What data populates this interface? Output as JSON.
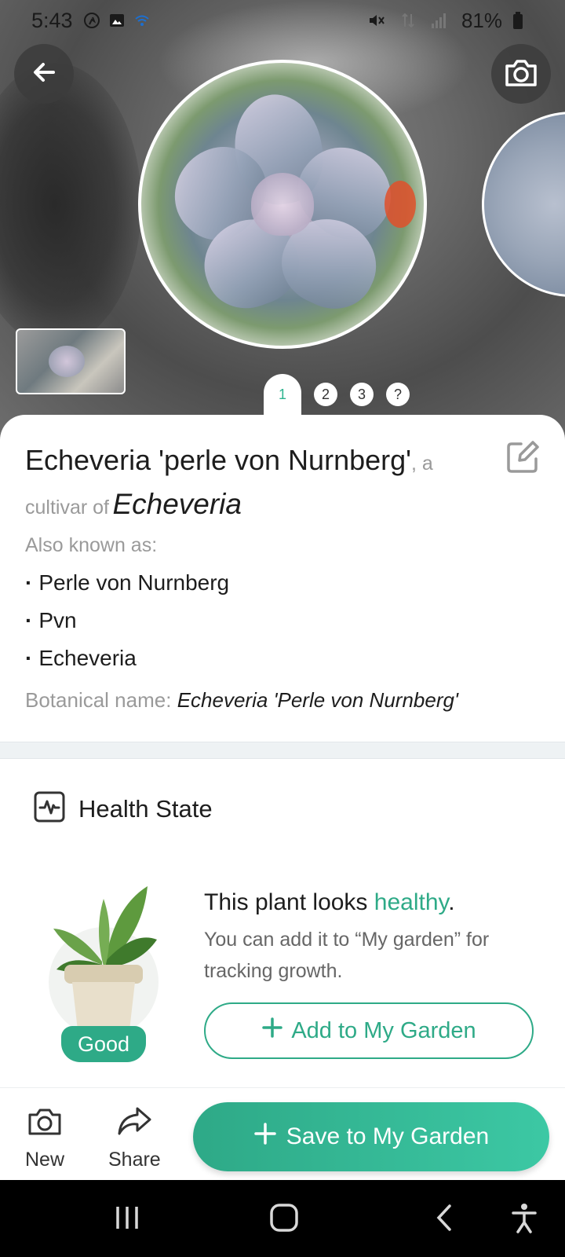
{
  "status_bar": {
    "time": "5:43",
    "battery": "81%"
  },
  "pagination": {
    "pages": [
      "1",
      "2",
      "3",
      "?"
    ]
  },
  "plant": {
    "common_name": "Echeveria 'perle von Nurnberg'",
    "cultivar_prefix": ", a",
    "cultivar_of": "cultivar of",
    "genus": "Echeveria",
    "aka_label": "Also known as:",
    "aka": [
      "Perle von Nurnberg",
      "Pvn",
      "Echeveria"
    ],
    "botanical_label": "Botanical name:",
    "botanical_value": "Echeveria 'Perle von Nurnberg'"
  },
  "health": {
    "title": "Health State",
    "badge": "Good",
    "status_prefix": "This plant looks ",
    "status_word": "healthy",
    "status_suffix": ".",
    "description": "You can add it to “My garden” for tracking growth.",
    "add_button": "Add to My Garden"
  },
  "bottom_bar": {
    "new_label": "New",
    "share_label": "Share",
    "save_label": "Save to My Garden"
  },
  "colors": {
    "accent": "#2eaa87",
    "accent_light": "#3cc8a4"
  },
  "icons": [
    "back-icon",
    "camera-icon",
    "edit-icon",
    "health-pulse-icon",
    "plus-icon",
    "share-icon",
    "recents-icon",
    "home-icon",
    "nav-back-icon",
    "accessibility-icon"
  ]
}
